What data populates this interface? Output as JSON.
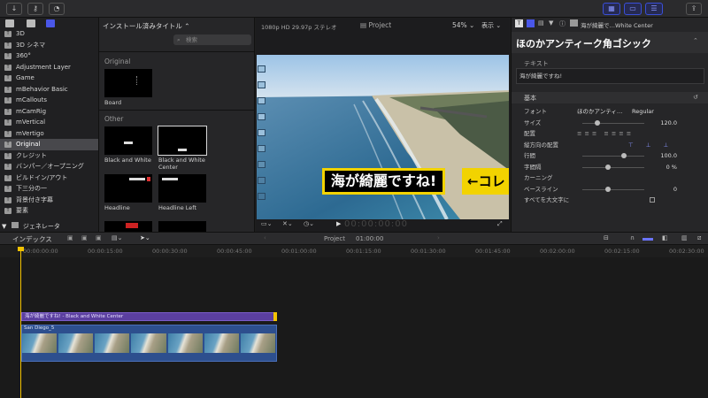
{
  "sidebar": {
    "header": "",
    "items": [
      {
        "label": "3D"
      },
      {
        "label": "3D シネマ"
      },
      {
        "label": "360°"
      },
      {
        "label": "Adjustment Layer"
      },
      {
        "label": "Game"
      },
      {
        "label": "mBehavior Basic"
      },
      {
        "label": "mCallouts"
      },
      {
        "label": "mCamRig"
      },
      {
        "label": "mVertical"
      },
      {
        "label": "mVertigo"
      },
      {
        "label": "Original"
      },
      {
        "label": "クレジット"
      },
      {
        "label": "バンパー／オープニング"
      },
      {
        "label": "ビルドイン/アウト"
      },
      {
        "label": "下三分の一"
      },
      {
        "label": "背景付き字幕"
      },
      {
        "label": "要素"
      }
    ],
    "footer": "ジェネレータ"
  },
  "browser": {
    "title": "インストール済みタイトル",
    "search_placeholder": "検索",
    "section_original": "Original",
    "section_other": "Other",
    "thumbs": [
      {
        "label": "Board"
      },
      {
        "label": "Black and White"
      },
      {
        "label": "Black and White Center"
      },
      {
        "label": "Headline"
      },
      {
        "label": "Headline Left"
      }
    ]
  },
  "viewer": {
    "format": "1080p HD 29.97p ステレオ",
    "project": "Project",
    "zoom": "54%",
    "display": "表示",
    "title_text": "海が綺麗ですね!",
    "callout": "←コレ",
    "timecode": "00:00:00:00"
  },
  "inspector": {
    "header": "海が綺麗で…White Center",
    "font_name": "ほのかアンティーク角ゴシック",
    "text_section": "テキスト",
    "text_value": "海が綺麗ですね!",
    "basic_section": "基本",
    "rows": [
      {
        "label": "フォント",
        "value": "ほのかアンティ…",
        "value2": "Regular"
      },
      {
        "label": "サイズ",
        "value": "120.0"
      },
      {
        "label": "配置",
        "value": ""
      },
      {
        "label": "縦方向の配置",
        "value": ""
      },
      {
        "label": "行間",
        "value": "100.0"
      },
      {
        "label": "字間隔",
        "value": "0 %"
      },
      {
        "label": "カーニング",
        "value": ""
      },
      {
        "label": "ベースライン",
        "value": "0"
      },
      {
        "label": "すべてを大文字に",
        "value": ""
      }
    ]
  },
  "timeline": {
    "index_label": "インデックス",
    "project": "Project",
    "duration": "01:00:00",
    "ruler": [
      "00:00:00:00",
      "00:00:15:00",
      "00:00:30:00",
      "00:00:45:00",
      "00:01:00:00",
      "00:01:15:00",
      "00:01:30:00",
      "00:01:45:00",
      "00:02:00:00",
      "00:02:15:00",
      "00:02:30:00"
    ],
    "title_clip": "海が綺麗ですね! - Black and White Center",
    "video_clip": "San Diego_5"
  }
}
